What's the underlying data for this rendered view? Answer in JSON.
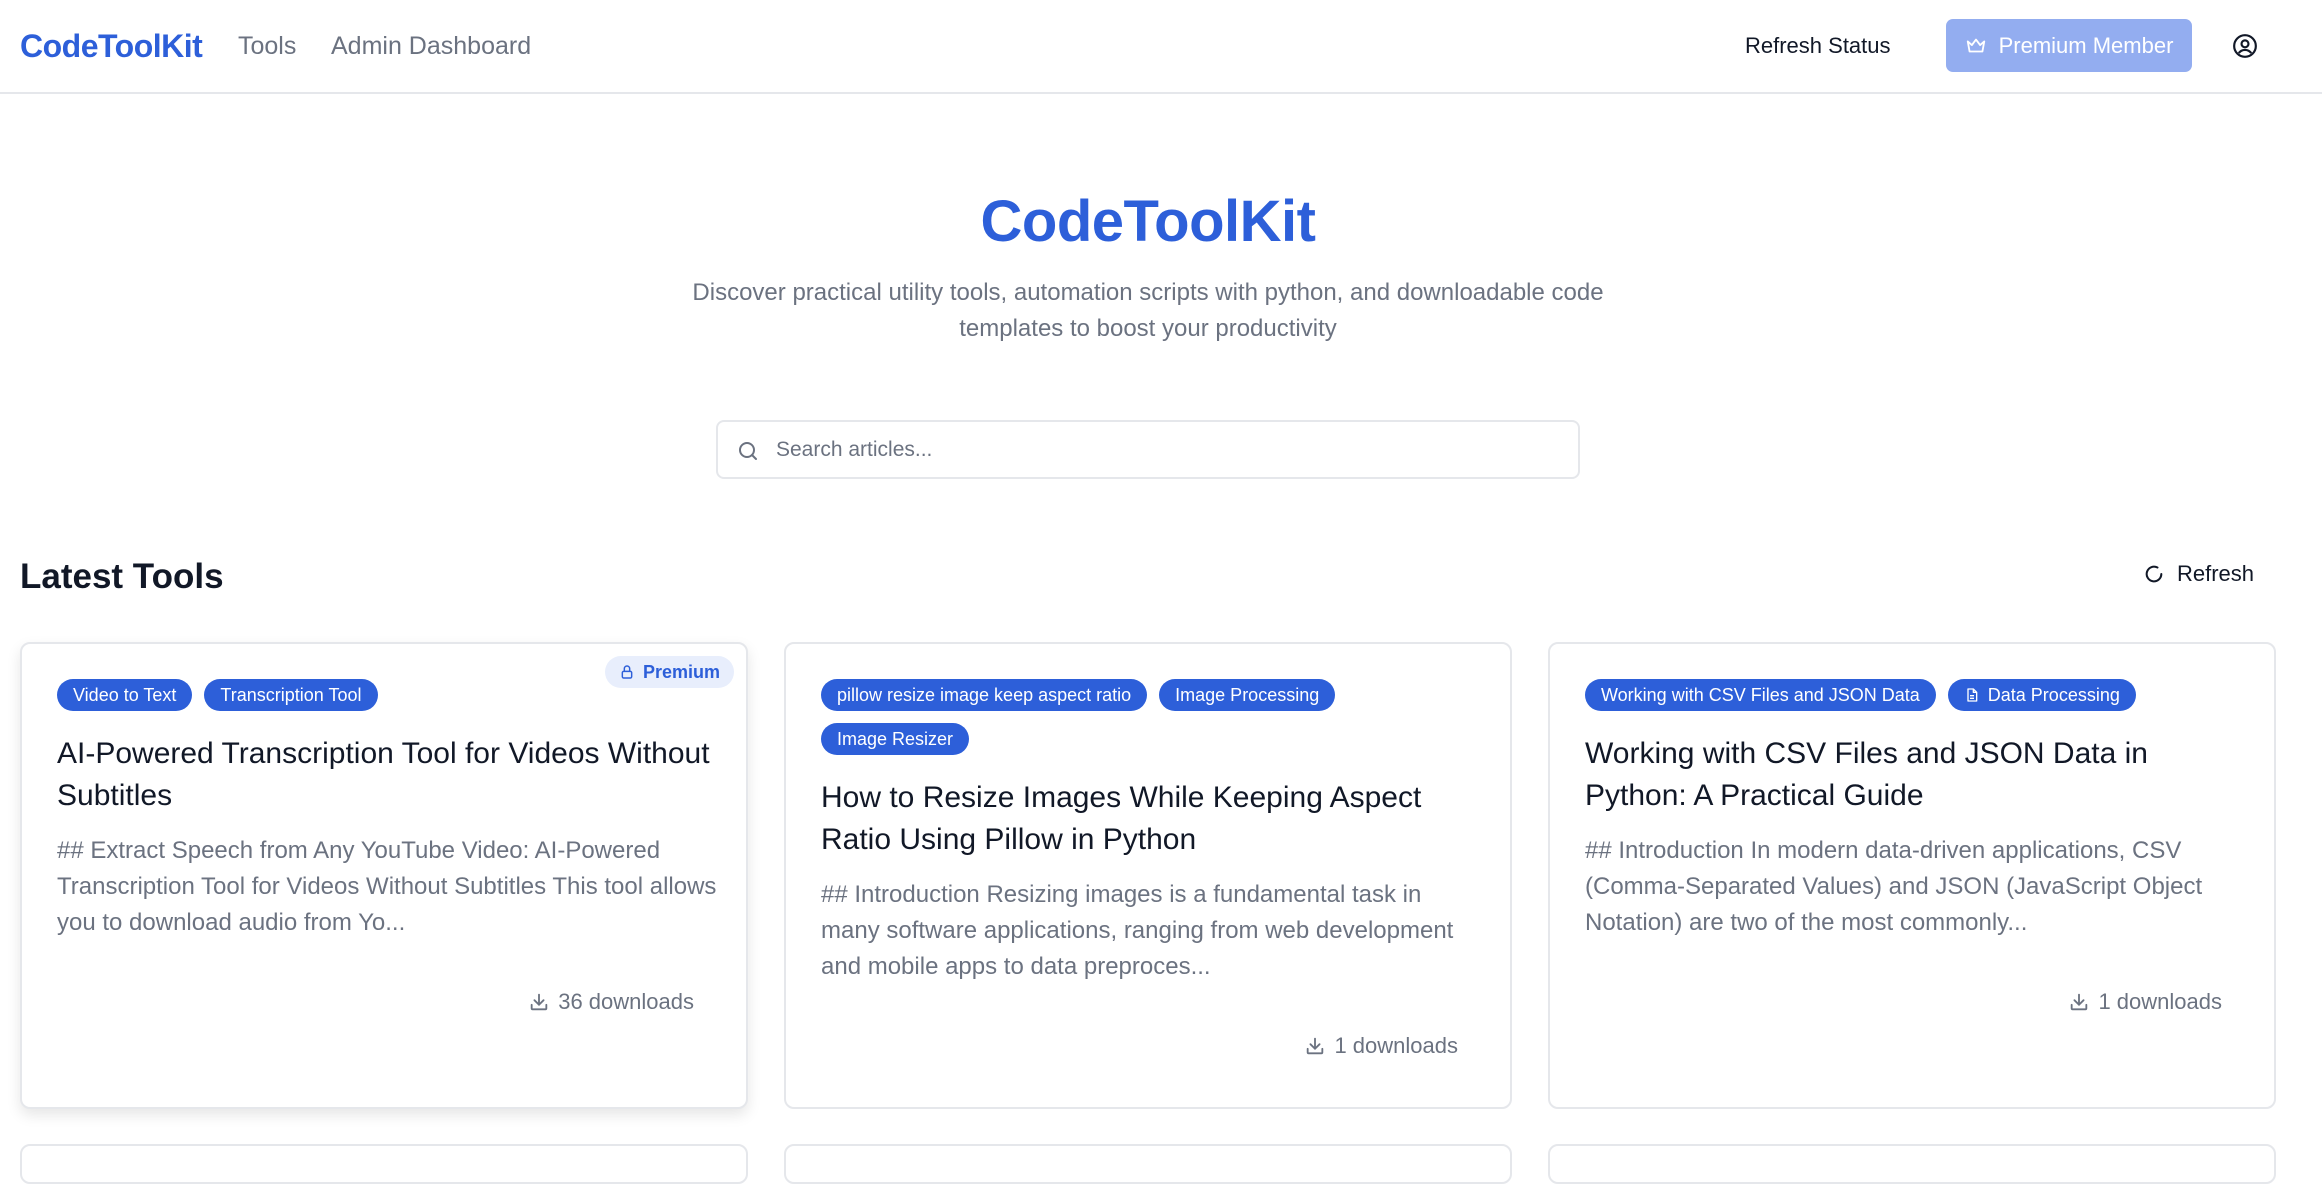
{
  "navbar": {
    "brand": "CodeToolKit",
    "links": [
      "Tools",
      "Admin Dashboard"
    ],
    "refresh_status": "Refresh Status",
    "premium_label": "Premium Member",
    "user_icon": "user-circle-icon"
  },
  "hero": {
    "title": "CodeToolKit",
    "subtitle": "Discover practical utility tools, automation scripts with python, and downloadable code templates to boost your productivity"
  },
  "search": {
    "placeholder": "Search articles..."
  },
  "section": {
    "title": "Latest Tools",
    "refresh_label": "Refresh"
  },
  "colors": {
    "brand": "#2d5fd9",
    "premium_button": "#93adf0",
    "tag": "#2d5fd9",
    "muted_text": "#6b7280"
  },
  "cards": [
    {
      "tags": [
        "Video to Text",
        "Transcription Tool"
      ],
      "premium_badge": "Premium",
      "title": "AI-Powered Transcription Tool for Videos Without Subtitles",
      "excerpt": "## Extract Speech from Any YouTube Video: AI-Powered Transcription Tool for Videos Without Subtitles This tool allows you to download audio from Yo...",
      "downloads": "36 downloads"
    },
    {
      "tags": [
        "pillow resize image keep aspect ratio",
        "Image Processing",
        "Image Resizer"
      ],
      "title": "How to Resize Images While Keeping Aspect Ratio Using Pillow in Python",
      "excerpt": "## Introduction Resizing images is a fundamental task in many software applications, ranging from web development and mobile apps to data preproces...",
      "downloads": "1 downloads"
    },
    {
      "tags": [
        "Working with CSV Files and JSON Data",
        "Data Processing"
      ],
      "title": "Working with CSV Files and JSON Data in Python: A Practical Guide",
      "excerpt": "## Introduction In modern data-driven applications, CSV (Comma-Separated Values) and JSON (JavaScript Object Notation) are two of the most commonly...",
      "downloads": "1 downloads"
    }
  ]
}
